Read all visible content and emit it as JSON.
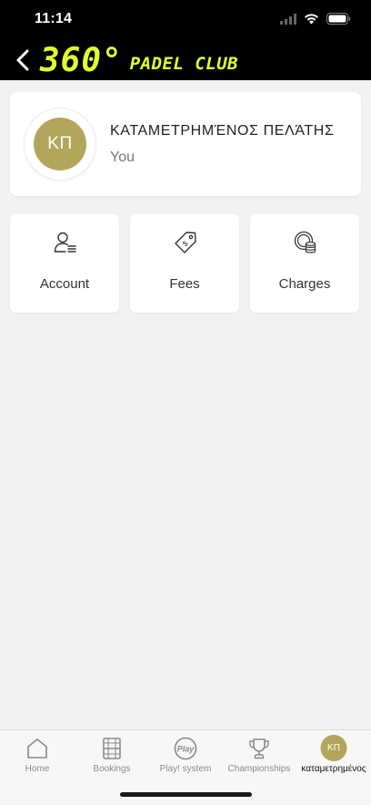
{
  "status_bar": {
    "time": "11:14"
  },
  "header": {
    "logo_number": "360°",
    "logo_text": "PADEL CLUB"
  },
  "profile": {
    "initials": "ΚΠ",
    "name": "ΚΑΤΑΜΕΤΡΗΜΈΝΟΣ ΠΕΛΆΤΗΣ",
    "subtitle": "You",
    "avatar_color": "#b2a65a"
  },
  "tiles": [
    {
      "label": "Account",
      "icon": "account-icon"
    },
    {
      "label": "Fees",
      "icon": "price-tag-icon"
    },
    {
      "label": "Charges",
      "icon": "coins-icon"
    }
  ],
  "tabbar": {
    "items": [
      {
        "label": "Home",
        "icon": "home-icon"
      },
      {
        "label": "Bookings",
        "icon": "bookings-icon"
      },
      {
        "label": "Play! system",
        "icon": "play-icon",
        "icon_text": "Play"
      },
      {
        "label": "Championships",
        "icon": "trophy-icon"
      },
      {
        "label": "καταμετρημένος",
        "icon": "avatar",
        "initials": "ΚΠ"
      }
    ],
    "active_index": 4
  },
  "colors": {
    "accent": "#e3ff2e",
    "avatar": "#b2a65a",
    "header_bg": "#000000",
    "page_bg": "#f2f2f2"
  }
}
